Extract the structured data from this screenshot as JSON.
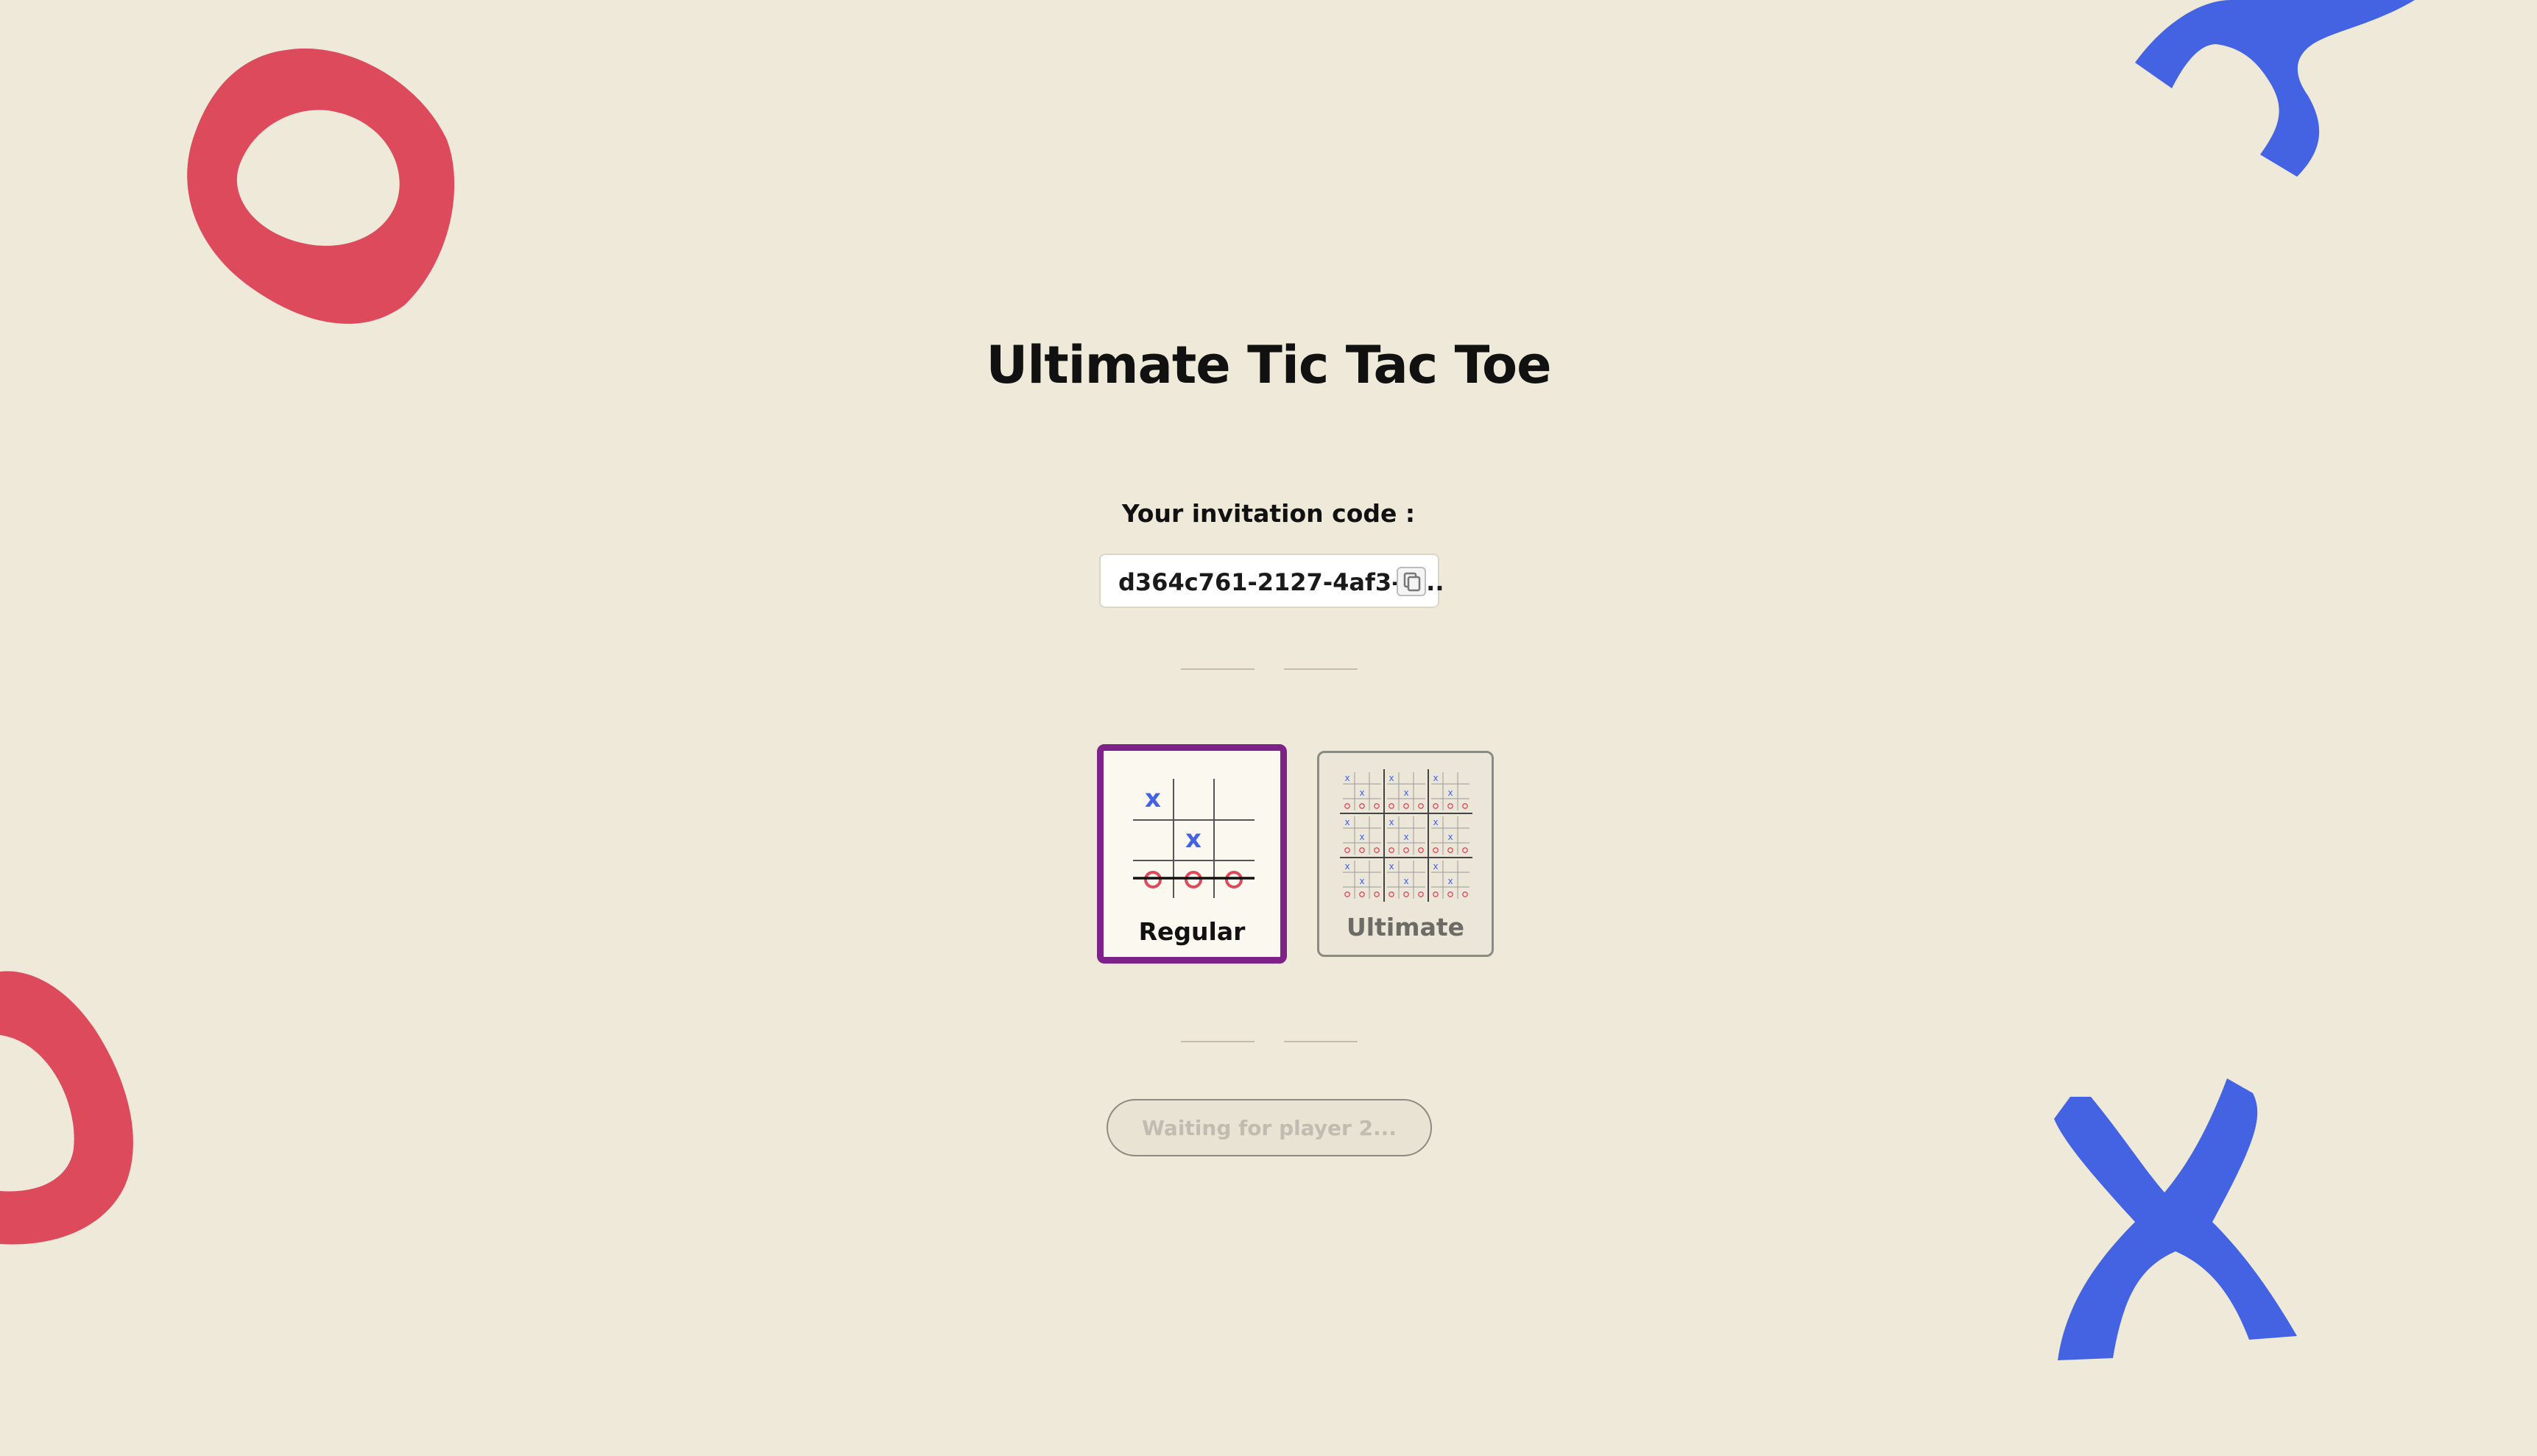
{
  "app": {
    "title": "Ultimate Tic Tac Toe"
  },
  "invitation": {
    "label": "Your invitation code :",
    "code": "d364c761-2127-4af3-a...",
    "copy_icon": "copy-icon"
  },
  "modes": [
    {
      "label": "Regular",
      "selected": true,
      "icon": "regular-board-icon"
    },
    {
      "label": "Ultimate",
      "selected": false,
      "icon": "ultimate-board-icon"
    }
  ],
  "status_button": {
    "label": "Waiting for player 2..."
  },
  "colors": {
    "background": "#efe9d9",
    "o_red": "#dc4a5b",
    "x_blue": "#4363e3",
    "selected_border": "#7e2189"
  }
}
